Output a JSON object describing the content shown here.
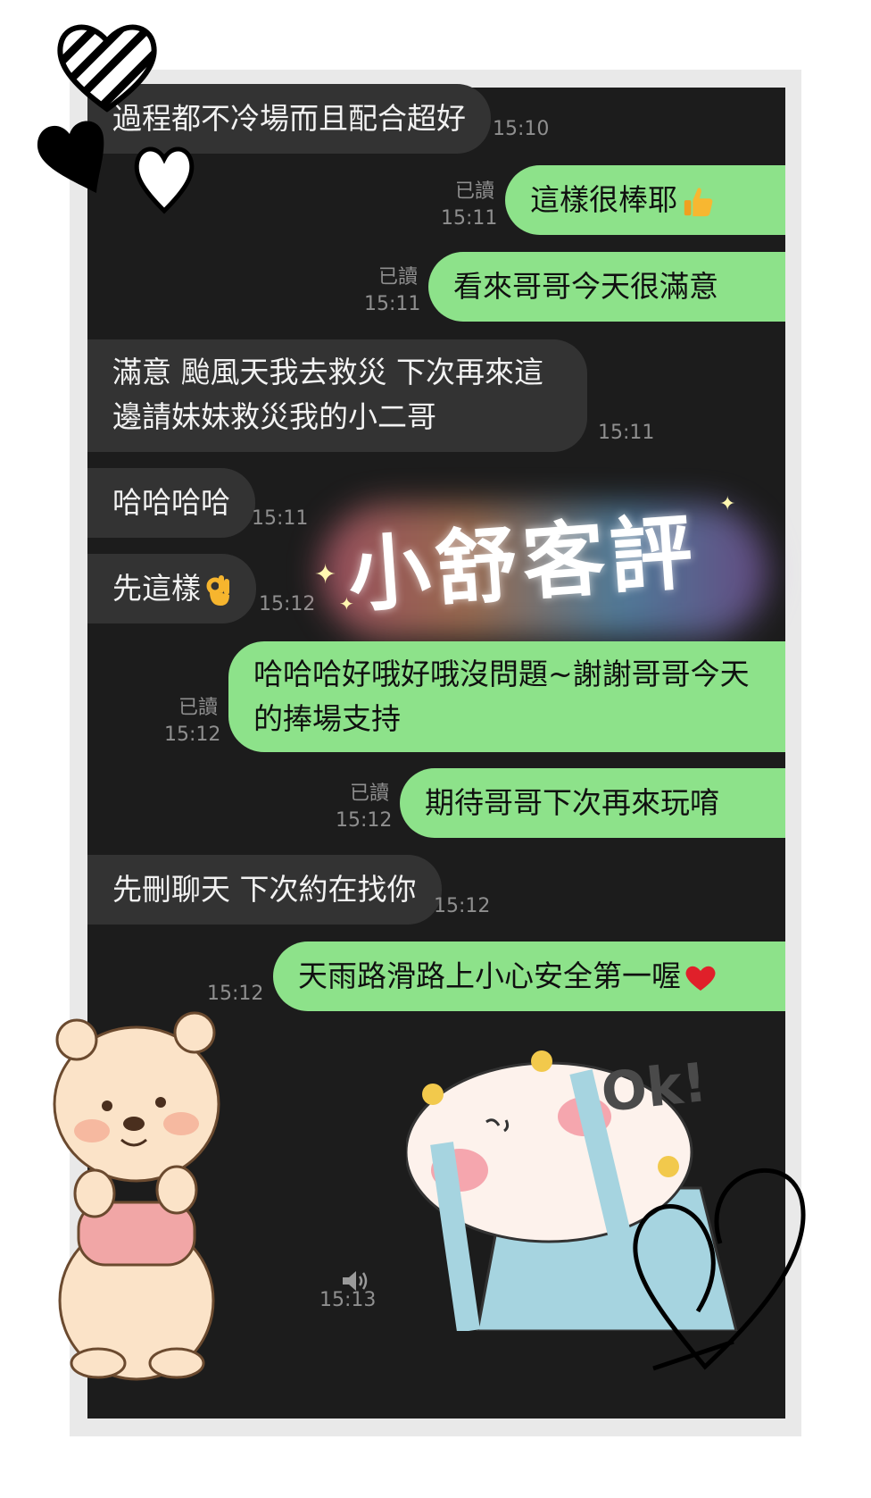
{
  "messages": [
    {
      "dir": "in",
      "text": "過程都不冷場而且配合超好",
      "time": "15:10"
    },
    {
      "dir": "out",
      "text": "這樣很棒耶",
      "emoji": "thumbs-up-icon",
      "read": "已讀",
      "time": "15:11"
    },
    {
      "dir": "out",
      "text": "看來哥哥今天很滿意",
      "read": "已讀",
      "time": "15:11"
    },
    {
      "dir": "in",
      "text": "滿意 颱風天我去救災 下次再來這邊請妹妹救災我的小二哥",
      "time": "15:11"
    },
    {
      "dir": "in",
      "text": "哈哈哈哈",
      "time": "15:11"
    },
    {
      "dir": "in",
      "text": "先這樣",
      "emoji": "ok-hand-icon",
      "time": "15:12"
    },
    {
      "dir": "out",
      "text": "哈哈哈好哦好哦沒問題~謝謝哥哥今天的捧場支持",
      "read": "已讀",
      "time": "15:12"
    },
    {
      "dir": "out",
      "text": "期待哥哥下次再來玩唷",
      "read": "已讀",
      "time": "15:12"
    },
    {
      "dir": "in",
      "text": "先刪聊天 下次約在找你",
      "time": "15:12"
    },
    {
      "dir": "out",
      "text": "天雨路滑路上小心安全第一喔",
      "emoji": "red-heart-icon",
      "time": "15:12"
    }
  ],
  "banner": "小舒客評",
  "sticker_text": "Ok!",
  "voice": {
    "icon": "speaker-icon",
    "time": "15:13"
  },
  "colors": {
    "chat_bg": "#1c1c1c",
    "incoming": "#333333",
    "outgoing": "#8de28a"
  }
}
